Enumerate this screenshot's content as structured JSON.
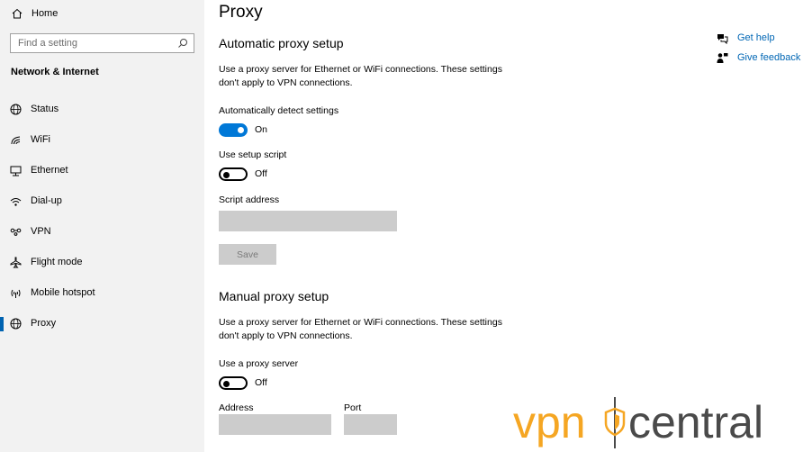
{
  "sidebar": {
    "home_label": "Home",
    "search_placeholder": "Find a setting",
    "section_title": "Network & Internet",
    "items": [
      {
        "label": "Status",
        "icon": "globe-status-icon"
      },
      {
        "label": "WiFi",
        "icon": "wifi-icon"
      },
      {
        "label": "Ethernet",
        "icon": "ethernet-icon"
      },
      {
        "label": "Dial-up",
        "icon": "dialup-icon"
      },
      {
        "label": "VPN",
        "icon": "vpn-icon"
      },
      {
        "label": "Flight mode",
        "icon": "airplane-icon"
      },
      {
        "label": "Mobile hotspot",
        "icon": "hotspot-icon"
      },
      {
        "label": "Proxy",
        "icon": "globe-icon",
        "active": true
      }
    ]
  },
  "main": {
    "title": "Proxy",
    "auto": {
      "heading": "Automatic proxy setup",
      "desc_line1": "Use a proxy server for Ethernet or WiFi connections. These settings",
      "desc_line2": "don't apply to VPN connections.",
      "detect_label": "Automatically detect settings",
      "detect_state": "On",
      "script_label": "Use setup script",
      "script_state": "Off",
      "address_label": "Script address",
      "address_value": "",
      "save_label": "Save"
    },
    "manual": {
      "heading": "Manual proxy setup",
      "desc_line1": "Use a proxy server for Ethernet or WiFi connections. These settings",
      "desc_line2": "don't apply to VPN connections.",
      "use_label": "Use a proxy server",
      "use_state": "Off",
      "address_label": "Address",
      "address_value": "",
      "port_label": "Port",
      "port_value": ""
    }
  },
  "help": {
    "get_help": "Get help",
    "give_feedback": "Give feedback"
  },
  "watermark": {
    "text_left": "vpn",
    "text_right": "central"
  },
  "colors": {
    "accent": "#0078d7",
    "link": "#0066b4",
    "sidebar_bg": "#f2f2f2",
    "watermark_orange": "#f5a623",
    "watermark_gray": "#4a4a4a"
  }
}
